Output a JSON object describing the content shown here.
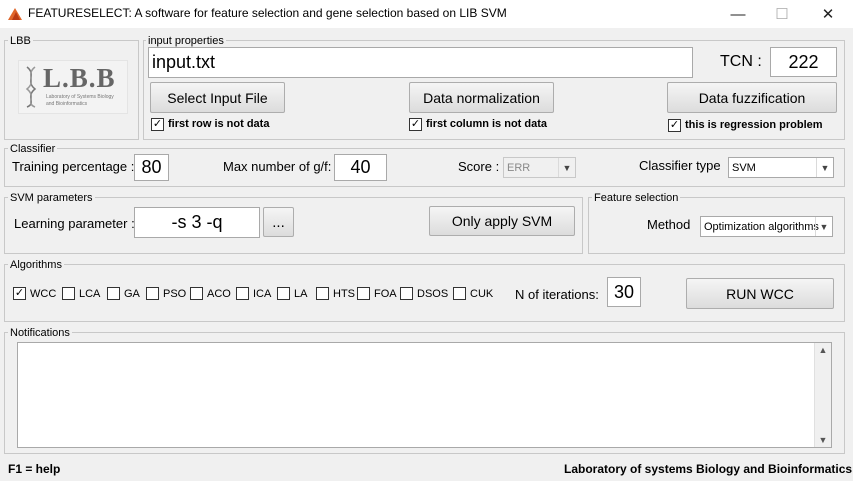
{
  "window": {
    "title": "FEATURESELECT: A software for feature selection and gene selection based on LIB SVM",
    "minimize": "—",
    "maximize": "☐",
    "close": "✕"
  },
  "lbb": {
    "group_label": "LBB",
    "logo_text": "L.B.B",
    "logo_sub1": "Laboratory of Systems Biology",
    "logo_sub2": "and Bioinformatics"
  },
  "input": {
    "group_label": "input properties",
    "file_value": "input.txt",
    "tcn_label": "TCN :",
    "tcn_value": "222",
    "select_file_button": "Select Input File",
    "normalization_button": "Data normalization",
    "fuzzification_button": "Data fuzzification",
    "first_row_label": "first row is not data",
    "first_row_checked": "✓",
    "first_column_label": "first column is not data",
    "first_column_checked": "✓",
    "regression_label": "this is regression problem",
    "regression_checked": "✓"
  },
  "classifier": {
    "group_label": "Classifier",
    "training_label": "Training percentage :",
    "training_value": "80",
    "max_label": "Max number of g/f:",
    "max_value": "40",
    "score_label": "Score :",
    "score_value": "ERR",
    "type_label": "Classifier type",
    "type_value": "SVM"
  },
  "svm": {
    "group_label": "SVM parameters",
    "learning_label": "Learning parameter :",
    "learning_value": "-s 3 -q",
    "browse_button": "...",
    "only_svm_button": "Only apply SVM"
  },
  "feature_selection": {
    "group_label": "Feature selection",
    "method_label": "Method",
    "method_value": "Optimization algorithms"
  },
  "algorithms": {
    "group_label": "Algorithms",
    "items": [
      {
        "label": "WCC",
        "mark": "✓"
      },
      {
        "label": "LCA",
        "mark": ""
      },
      {
        "label": "GA",
        "mark": ""
      },
      {
        "label": "PSO",
        "mark": ""
      },
      {
        "label": "ACO",
        "mark": ""
      },
      {
        "label": "ICA",
        "mark": ""
      },
      {
        "label": "LA",
        "mark": ""
      },
      {
        "label": "HTS",
        "mark": ""
      },
      {
        "label": "FOA",
        "mark": ""
      },
      {
        "label": "DSOS",
        "mark": ""
      },
      {
        "label": "CUK",
        "mark": ""
      }
    ],
    "iterations_label": "N of iterations:",
    "iterations_value": "30",
    "run_button": "RUN WCC"
  },
  "notifications": {
    "group_label": "Notifications",
    "content": "",
    "scroll_up": "▲",
    "scroll_down": "▼"
  },
  "footer": {
    "help": "F1 = help",
    "lab": "Laboratory of systems Biology and Bioinformatics"
  }
}
